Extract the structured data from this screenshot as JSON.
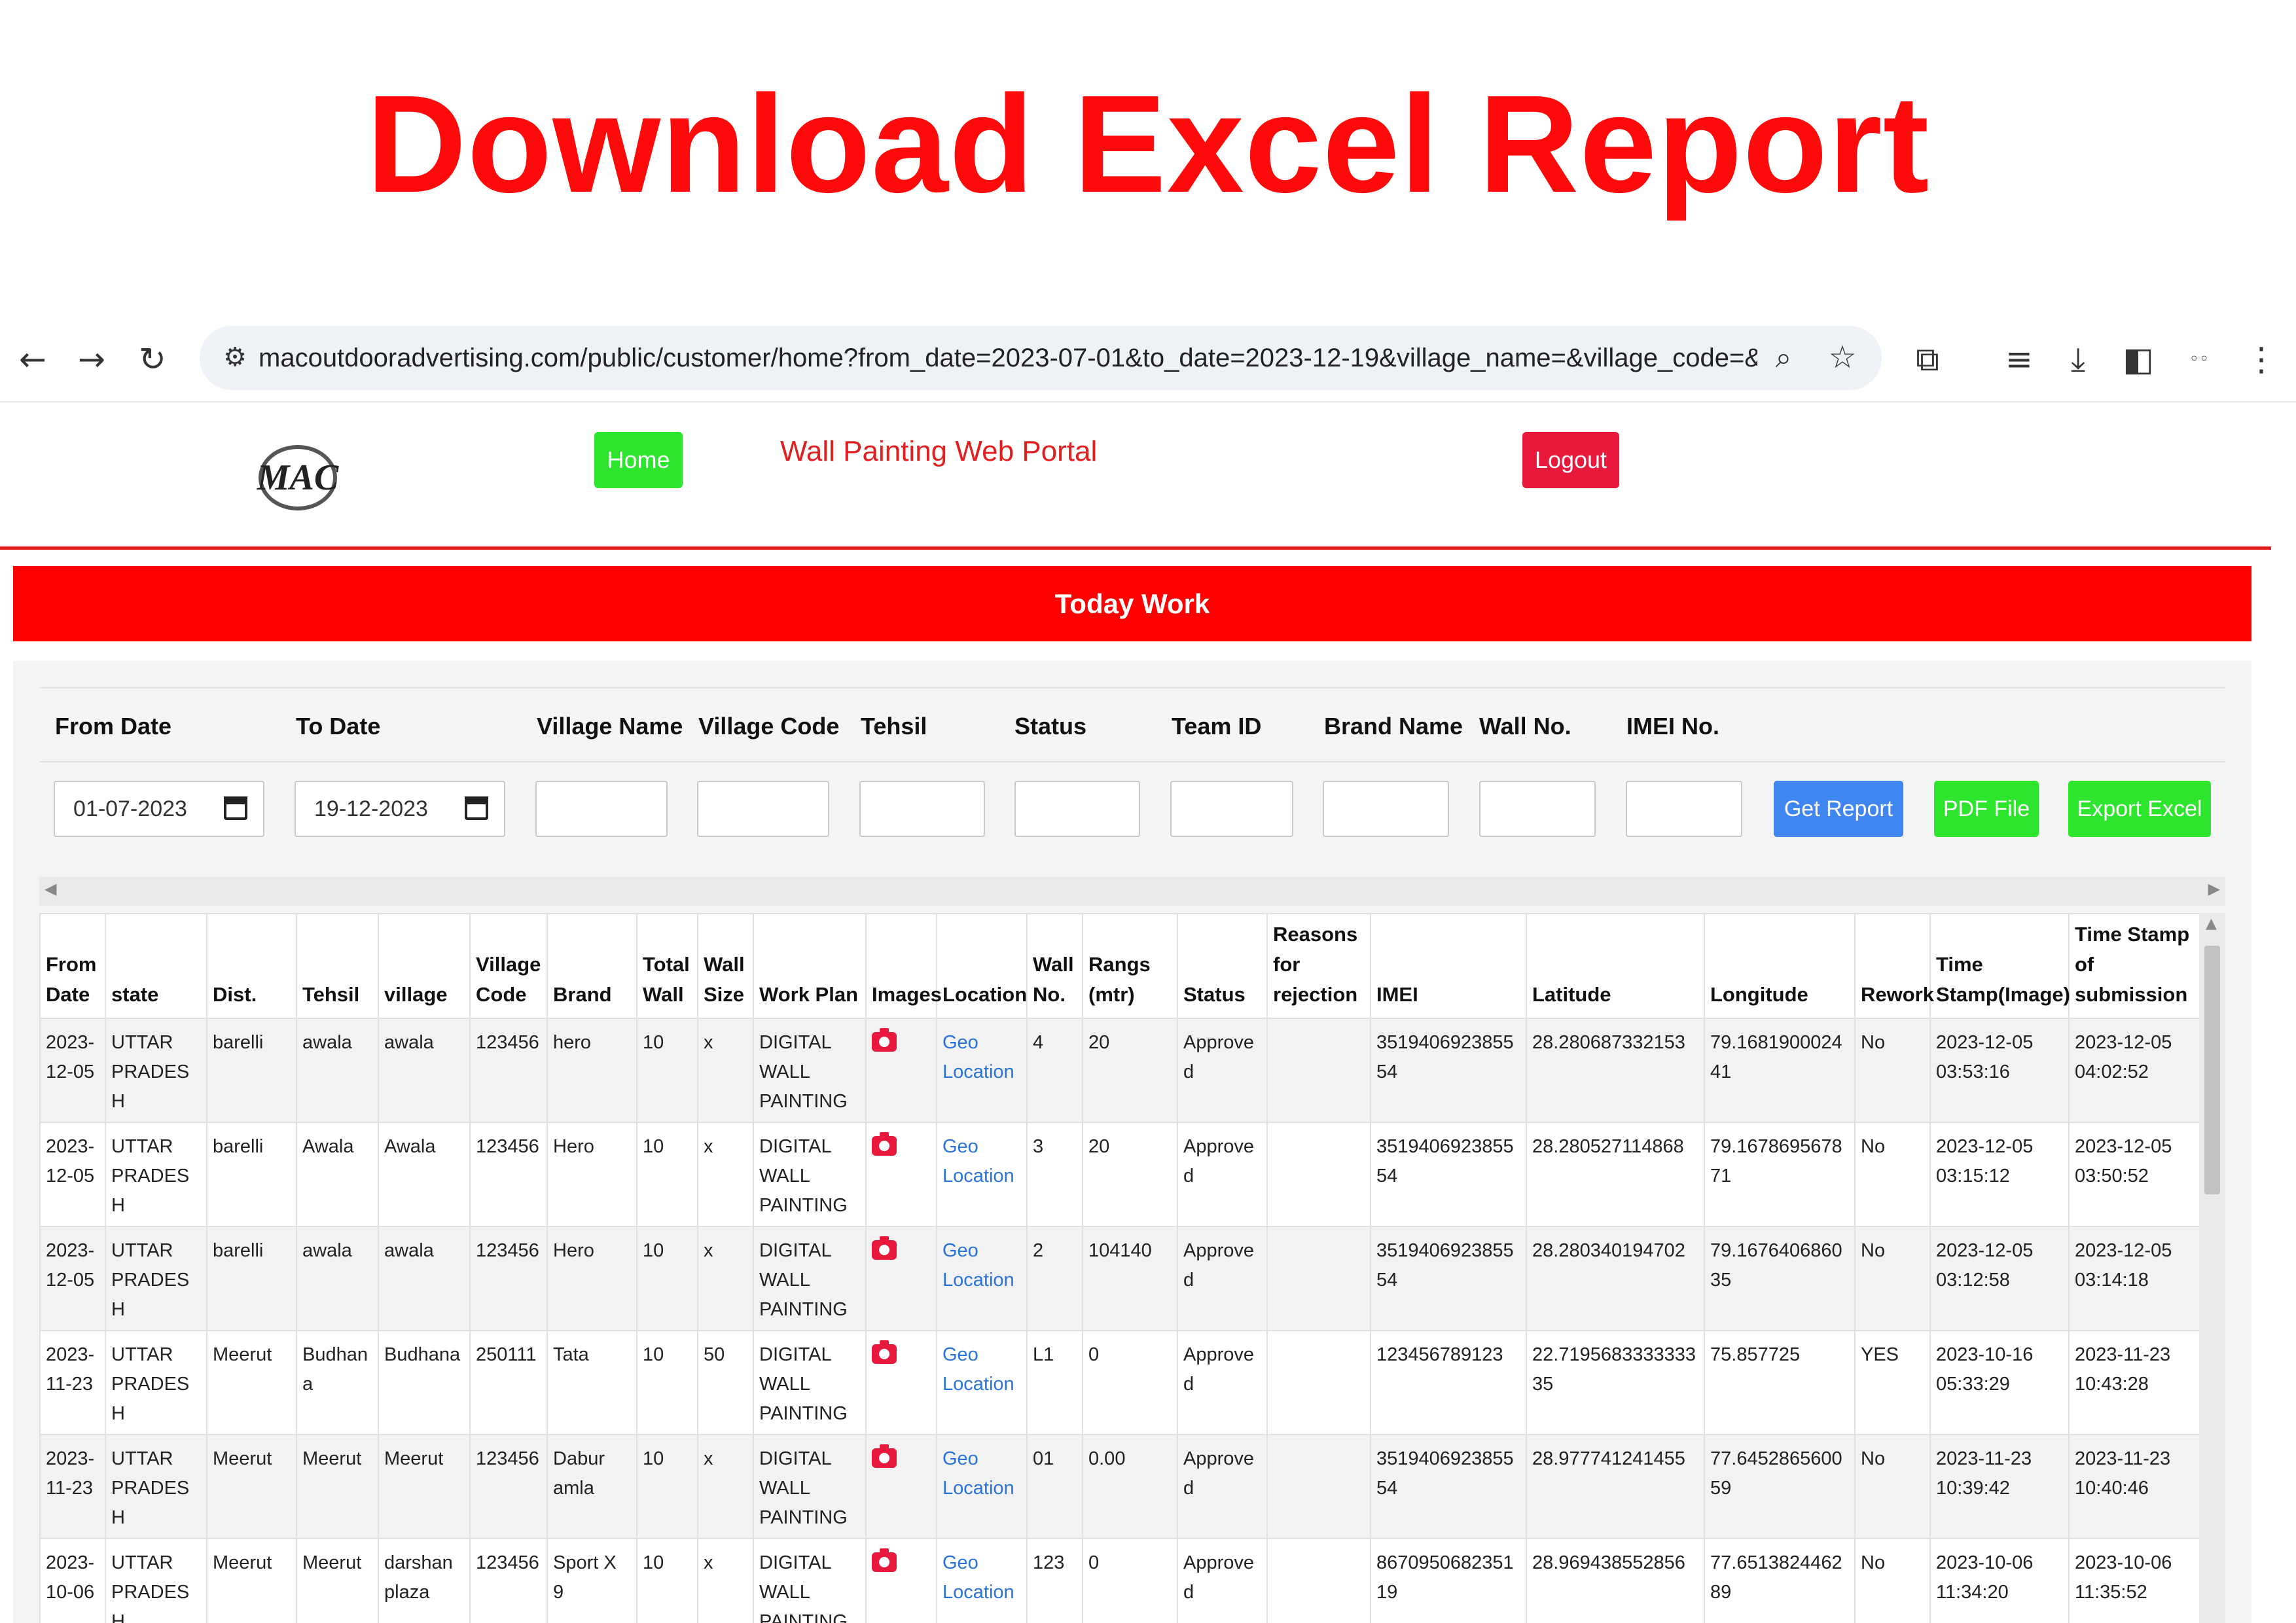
{
  "banner": {
    "title": "Download Excel Report"
  },
  "browser": {
    "url": "macoutdooradvertising.com/public/customer/home?from_date=2023-07-01&to_date=2023-12-19&village_name=&village_code=&tehsil_na..."
  },
  "header": {
    "logo_text": "MAC",
    "home_label": "Home",
    "portal_title": "Wall Painting Web Portal",
    "logout_label": "Logout"
  },
  "section_title": "Today Work",
  "filters": {
    "labels": [
      "From Date",
      "To Date",
      "Village Name",
      "Village Code",
      "Tehsil",
      "Status",
      "Team ID",
      "Brand Name",
      "Wall No.",
      "IMEI No."
    ],
    "from_date": "01-07-2023",
    "to_date": "19-12-2023",
    "get_report_label": "Get Report",
    "pdf_label": "PDF File",
    "export_label": "Export Excel"
  },
  "colors": {
    "banner_red": "#ff0a0a",
    "home_green": "#2ee52e",
    "logout_red": "#e8193c",
    "bar_red": "#ff0000",
    "get_report_blue": "#3f86f0",
    "link_blue": "#2a73d8"
  },
  "table": {
    "headers": [
      "From Date",
      "state",
      "Dist.",
      "Tehsil",
      "village",
      "Village Code",
      "Brand",
      "Total Wall",
      "Wall Size",
      "Work Plan",
      "Images",
      "Location",
      "Wall No.",
      "Rangs (mtr)",
      "Status",
      "Reasons for rejection",
      "IMEI",
      "Latitude",
      "Longitude",
      "Rework",
      "Time Stamp(Image)",
      "Time Stamp of submission"
    ],
    "location_label": "Geo Location",
    "rows": [
      [
        "2023-12-05",
        "UTTAR PRADESH",
        "barelli",
        "awala",
        "awala",
        "123456",
        "hero",
        "10",
        "x",
        "DIGITAL WALL PAINTING",
        "",
        "Geo Location",
        "4",
        "20",
        "Approved",
        "",
        "351940692385554",
        "28.280687332153",
        "79.168190002441",
        "No",
        "2023-12-05 03:53:16",
        "2023-12-05 04:02:52"
      ],
      [
        "2023-12-05",
        "UTTAR PRADESH",
        "barelli",
        "Awala",
        "Awala",
        "123456",
        "Hero",
        "10",
        "x",
        "DIGITAL WALL PAINTING",
        "",
        "Geo Location",
        "3",
        "20",
        "Approved",
        "",
        "351940692385554",
        "28.280527114868",
        "79.167869567871",
        "No",
        "2023-12-05 03:15:12",
        "2023-12-05 03:50:52"
      ],
      [
        "2023-12-05",
        "UTTAR PRADESH",
        "barelli",
        "awala",
        "awala",
        "123456",
        "Hero",
        "10",
        "x",
        "DIGITAL WALL PAINTING",
        "",
        "Geo Location",
        "2",
        "104140",
        "Approved",
        "",
        "351940692385554",
        "28.280340194702",
        "79.167640686035",
        "No",
        "2023-12-05 03:12:58",
        "2023-12-05 03:14:18"
      ],
      [
        "2023-11-23",
        "UTTAR PRADESH",
        "Meerut",
        "Budhana",
        "Budhana",
        "250111",
        "Tata",
        "10",
        "50",
        "DIGITAL WALL PAINTING",
        "",
        "Geo Location",
        "L1",
        "0",
        "Approved",
        "",
        "123456789123",
        "22.719568333333335",
        "75.857725",
        "YES",
        "2023-10-16 05:33:29",
        "2023-11-23 10:43:28"
      ],
      [
        "2023-11-23",
        "UTTAR PRADESH",
        "Meerut",
        "Meerut",
        "Meerut",
        "123456",
        "Dabur amla",
        "10",
        "x",
        "DIGITAL WALL PAINTING",
        "",
        "Geo Location",
        "01",
        "0.00",
        "Approved",
        "",
        "351940692385554",
        "28.977741241455",
        "77.645286560059",
        "No",
        "2023-11-23 10:39:42",
        "2023-11-23 10:40:46"
      ],
      [
        "2023-10-06",
        "UTTAR PRADESH",
        "Meerut",
        "Meerut",
        "darshan plaza",
        "123456",
        "Sport X 9",
        "10",
        "x",
        "DIGITAL WALL PAINTING",
        "",
        "Geo Location",
        "123",
        "0",
        "Approved",
        "",
        "867095068235119",
        "28.969438552856",
        "77.651382446289",
        "No",
        "2023-10-06 11:34:20",
        "2023-10-06 11:35:52"
      ]
    ]
  }
}
